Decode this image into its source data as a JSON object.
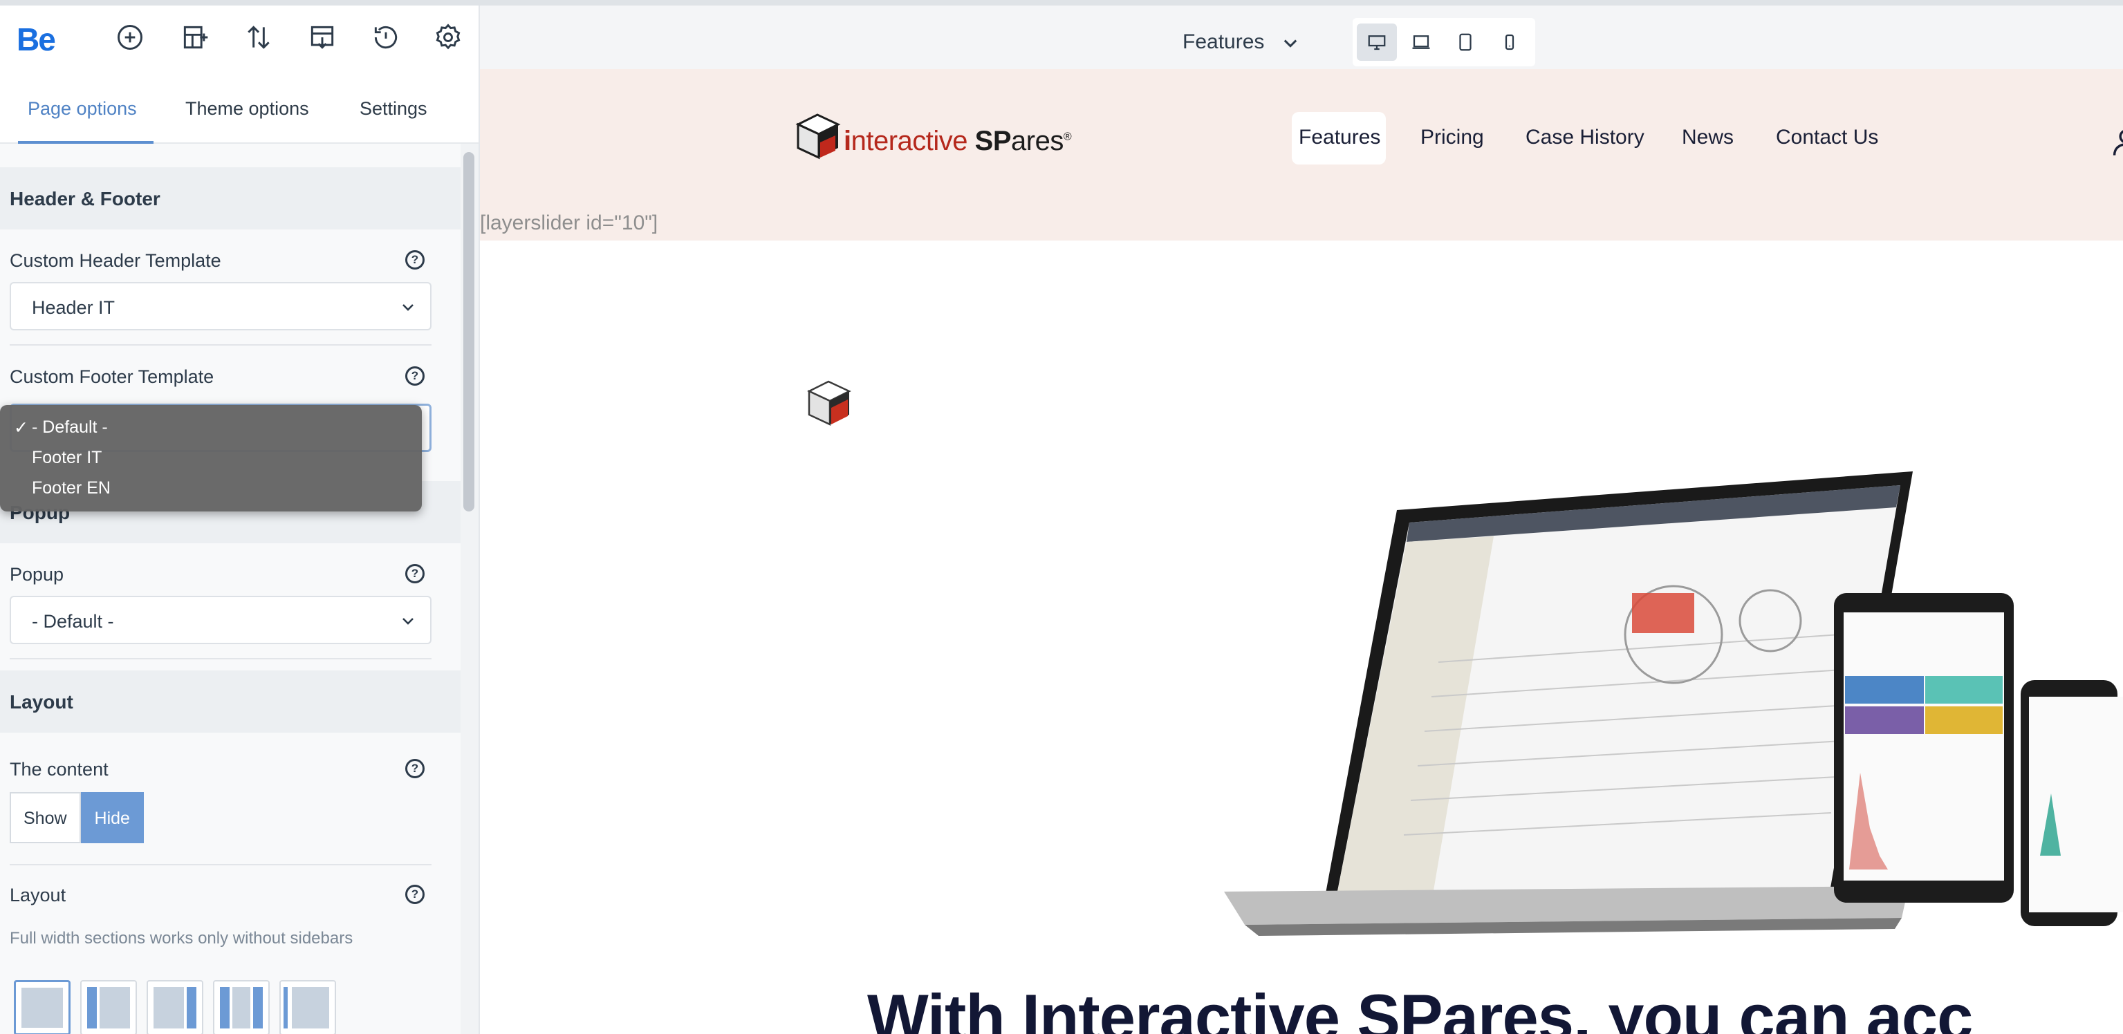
{
  "app": {
    "logo": "Be"
  },
  "toolbar_icons": [
    "add-icon",
    "add-section-icon",
    "sort-icon",
    "export-icon",
    "history-icon",
    "settings-icon"
  ],
  "tabs": [
    {
      "label": "Page options",
      "active": true
    },
    {
      "label": "Theme options",
      "active": false
    },
    {
      "label": "Settings",
      "active": false
    }
  ],
  "sections": {
    "header_footer": {
      "title": "Header & Footer",
      "custom_header": {
        "label": "Custom Header Template",
        "value": "Header IT"
      },
      "custom_footer": {
        "label": "Custom Footer Template",
        "options": [
          "- Default -",
          "Footer IT",
          "Footer EN"
        ],
        "selected": "- Default -"
      }
    },
    "popup": {
      "title": "Popup",
      "field": {
        "label": "Popup",
        "value": "- Default -"
      }
    },
    "layout": {
      "title": "Layout",
      "content": {
        "label": "The content",
        "options": [
          "Show",
          "Hide"
        ],
        "selected": "Hide"
      },
      "layout_field": {
        "label": "Layout",
        "note": "Full width sections works only without sidebars"
      }
    }
  },
  "preview_bar": {
    "page": "Features",
    "devices": [
      "desktop-icon",
      "laptop-icon",
      "tablet-icon",
      "mobile-icon"
    ],
    "active_device": "desktop-icon"
  },
  "site": {
    "brand": {
      "i": "i",
      "nteractive": "nteractive ",
      "SP": "SP",
      "ares": "ares",
      "reg": "®"
    },
    "nav": [
      "Features",
      "Pricing",
      "Case History",
      "News",
      "Contact Us"
    ],
    "active_nav": "Features",
    "shortcode": "[layerslider id=\"10\"]",
    "headline": "With Interactive SPares, you can acc"
  },
  "colors": {
    "accent": "#5d8fd0",
    "header_bg": "#f8ede9",
    "brand_red": "#b5281c"
  }
}
